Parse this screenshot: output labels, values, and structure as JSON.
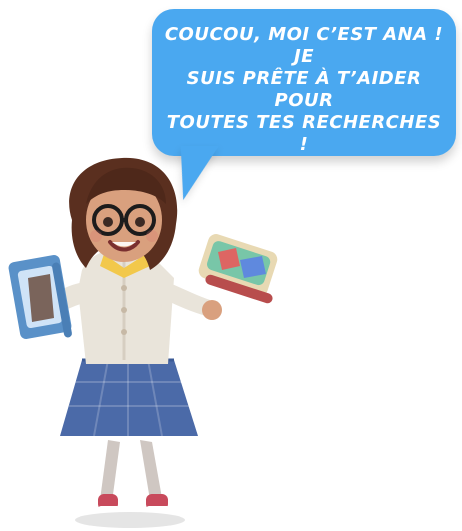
{
  "speech_bubble": {
    "lines": [
      "COUCOU, MOI C’EST ANA ! JE",
      "SUIS PRÊTE À T’AIDER POUR",
      "TOUTES TES RECHERCHES !"
    ]
  },
  "colors": {
    "bubble": "#4aa8f0",
    "text": "#ffffff",
    "skirt": "#4b6aa8",
    "cardigan": "#e9e4da",
    "hair": "#5a2f1f",
    "skin": "#d9a07e",
    "book_left": "#5a91c8",
    "book_right": "#e8d9b3",
    "shoes": "#c84a5c"
  },
  "figure": {
    "name": "Ana"
  }
}
